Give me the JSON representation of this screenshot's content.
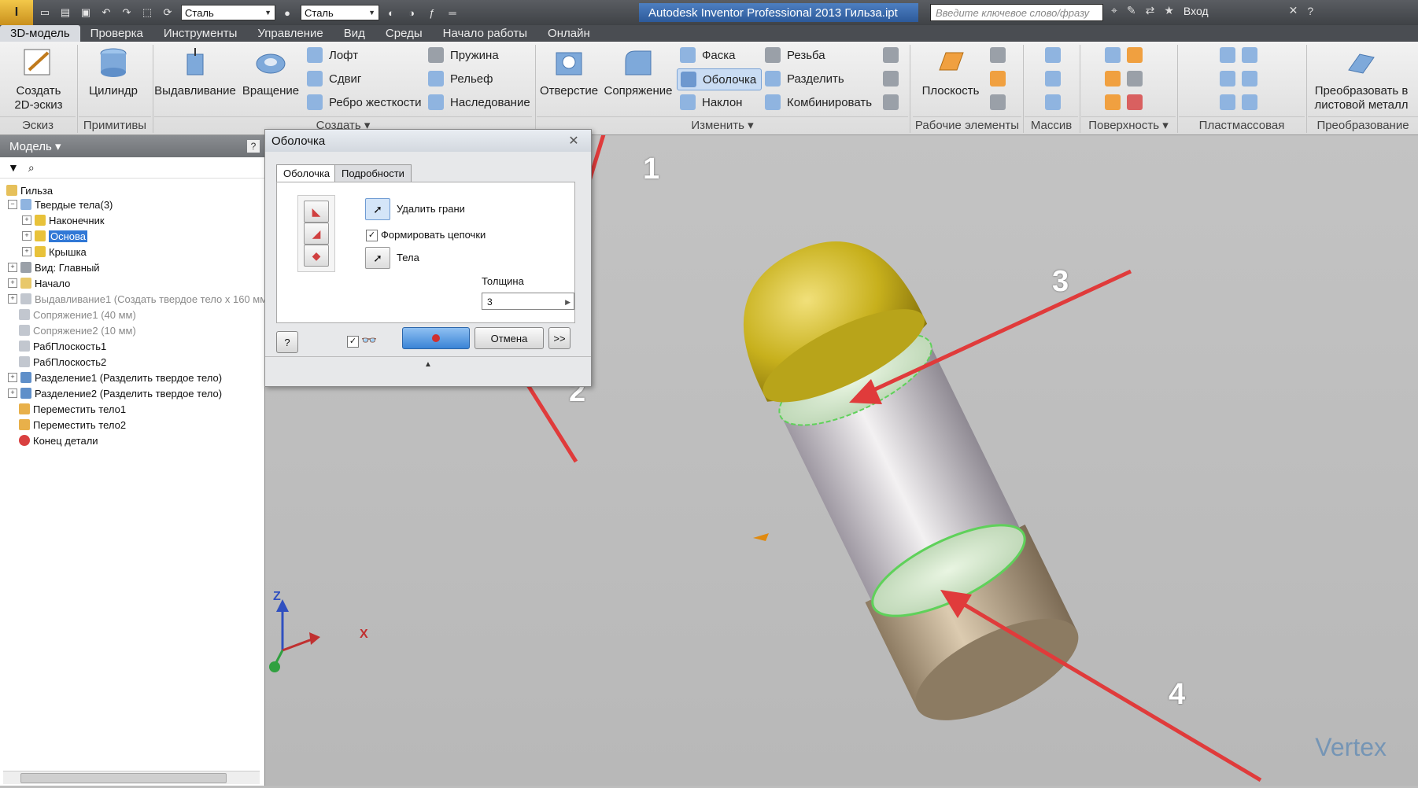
{
  "titlebar": {
    "material_combo": "Сталь",
    "appearance_combo": "Сталь",
    "window_title": "Autodesk Inventor Professional 2013   Гильза.ipt",
    "search_placeholder": "Введите ключевое слово/фразу",
    "login_label": "Вход"
  },
  "menu": {
    "tabs": [
      "3D-модель",
      "Проверка",
      "Инструменты",
      "Управление",
      "Вид",
      "Среды",
      "Начало работы",
      "Онлайн"
    ],
    "active_tab": "3D-модель"
  },
  "ribbon": {
    "sketch": {
      "create_2d_sketch": "Создать\n2D-эскиз",
      "group": "Эскиз"
    },
    "primitives": {
      "cylinder": "Цилиндр",
      "group": "Примитивы"
    },
    "create": {
      "extrude": "Выдавливание",
      "revolve": "Вращение",
      "loft": "Лофт",
      "sweep": "Сдвиг",
      "rib": "Ребро жесткости",
      "coil": "Пружина",
      "emboss": "Рельеф",
      "derive": "Наследование",
      "group": "Создать"
    },
    "modify": {
      "hole": "Отверстие",
      "fillet": "Сопряжение",
      "chamfer": "Фаска",
      "shell": "Оболочка",
      "draft": "Наклон",
      "thread": "Резьба",
      "split": "Разделить",
      "combine": "Комбинировать",
      "group": "Изменить"
    },
    "work_features": {
      "plane": "Плоскость",
      "group": "Рабочие элементы"
    },
    "pattern": {
      "group": "Массив"
    },
    "surface": {
      "group": "Поверхность"
    },
    "plastic": {
      "group": "Пластмассовая деталь"
    },
    "convert": {
      "sheet_metal": "Преобразовать в\nлистовой металл",
      "group": "Преобразование"
    }
  },
  "browser": {
    "title": "Модель",
    "tree": [
      {
        "label": "Гильза",
        "level": 0
      },
      {
        "label": "Твердые тела(3)",
        "level": 1
      },
      {
        "label": "Наконечник",
        "level": 2
      },
      {
        "label": "Основа",
        "level": 2,
        "selected": true
      },
      {
        "label": "Крышка",
        "level": 2
      },
      {
        "label": "Вид: Главный",
        "level": 1
      },
      {
        "label": "Начало",
        "level": 1
      },
      {
        "label": "Выдавливание1 (Создать твердое тело x 160 мм",
        "level": 1,
        "grey": true
      },
      {
        "label": "Сопряжение1 (40 мм)",
        "level": 1,
        "grey": true
      },
      {
        "label": "Сопряжение2 (10 мм)",
        "level": 1,
        "grey": true
      },
      {
        "label": "РабПлоскость1",
        "level": 1
      },
      {
        "label": "РабПлоскость2",
        "level": 1
      },
      {
        "label": "Разделение1 (Разделить твердое тело)",
        "level": 1
      },
      {
        "label": "Разделение2 (Разделить твердое тело)",
        "level": 1
      },
      {
        "label": "Переместить тело1",
        "level": 1
      },
      {
        "label": "Переместить тело2",
        "level": 1
      },
      {
        "label": "Конец детали",
        "level": 1
      }
    ]
  },
  "dialog": {
    "title": "Оболочка",
    "tabs": [
      "Оболочка",
      "Подробности"
    ],
    "remove_faces": "Удалить грани",
    "chain_faces": "Формировать цепочки",
    "bodies": "Тела",
    "thickness_label": "Толщина",
    "thickness_value": "3",
    "cancel": "Отмена",
    "more": ">>",
    "help": "?"
  },
  "annotations": {
    "n1": "1",
    "n2": "2",
    "n3": "3",
    "n4": "4"
  },
  "axes": {
    "z": "Z",
    "x": "X"
  },
  "watermark": "Vertex",
  "colors": {
    "accent": "#2d5a9a",
    "arrow": "#e03b3b",
    "cap": "#c8b21e",
    "base": "#b9a68c"
  }
}
